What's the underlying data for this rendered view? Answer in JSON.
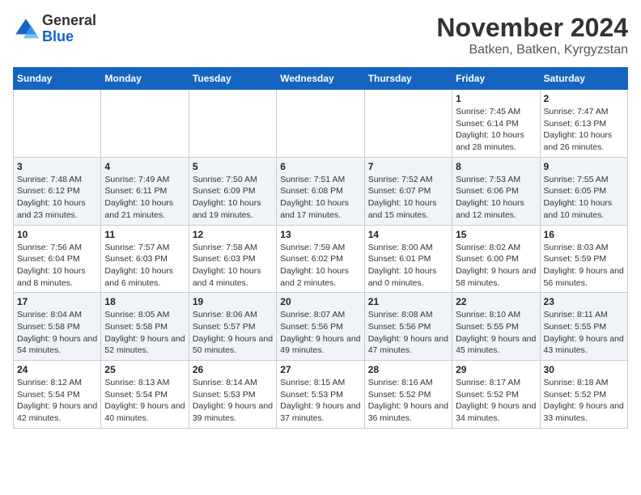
{
  "header": {
    "logo": {
      "general": "General",
      "blue": "Blue"
    },
    "title": "November 2024",
    "location": "Batken, Batken, Kyrgyzstan"
  },
  "weekdays": [
    "Sunday",
    "Monday",
    "Tuesday",
    "Wednesday",
    "Thursday",
    "Friday",
    "Saturday"
  ],
  "weeks": [
    [
      {
        "day": "",
        "info": ""
      },
      {
        "day": "",
        "info": ""
      },
      {
        "day": "",
        "info": ""
      },
      {
        "day": "",
        "info": ""
      },
      {
        "day": "",
        "info": ""
      },
      {
        "day": "1",
        "info": "Sunrise: 7:45 AM\nSunset: 6:14 PM\nDaylight: 10 hours and 28 minutes."
      },
      {
        "day": "2",
        "info": "Sunrise: 7:47 AM\nSunset: 6:13 PM\nDaylight: 10 hours and 26 minutes."
      }
    ],
    [
      {
        "day": "3",
        "info": "Sunrise: 7:48 AM\nSunset: 6:12 PM\nDaylight: 10 hours and 23 minutes."
      },
      {
        "day": "4",
        "info": "Sunrise: 7:49 AM\nSunset: 6:11 PM\nDaylight: 10 hours and 21 minutes."
      },
      {
        "day": "5",
        "info": "Sunrise: 7:50 AM\nSunset: 6:09 PM\nDaylight: 10 hours and 19 minutes."
      },
      {
        "day": "6",
        "info": "Sunrise: 7:51 AM\nSunset: 6:08 PM\nDaylight: 10 hours and 17 minutes."
      },
      {
        "day": "7",
        "info": "Sunrise: 7:52 AM\nSunset: 6:07 PM\nDaylight: 10 hours and 15 minutes."
      },
      {
        "day": "8",
        "info": "Sunrise: 7:53 AM\nSunset: 6:06 PM\nDaylight: 10 hours and 12 minutes."
      },
      {
        "day": "9",
        "info": "Sunrise: 7:55 AM\nSunset: 6:05 PM\nDaylight: 10 hours and 10 minutes."
      }
    ],
    [
      {
        "day": "10",
        "info": "Sunrise: 7:56 AM\nSunset: 6:04 PM\nDaylight: 10 hours and 8 minutes."
      },
      {
        "day": "11",
        "info": "Sunrise: 7:57 AM\nSunset: 6:03 PM\nDaylight: 10 hours and 6 minutes."
      },
      {
        "day": "12",
        "info": "Sunrise: 7:58 AM\nSunset: 6:03 PM\nDaylight: 10 hours and 4 minutes."
      },
      {
        "day": "13",
        "info": "Sunrise: 7:59 AM\nSunset: 6:02 PM\nDaylight: 10 hours and 2 minutes."
      },
      {
        "day": "14",
        "info": "Sunrise: 8:00 AM\nSunset: 6:01 PM\nDaylight: 10 hours and 0 minutes."
      },
      {
        "day": "15",
        "info": "Sunrise: 8:02 AM\nSunset: 6:00 PM\nDaylight: 9 hours and 58 minutes."
      },
      {
        "day": "16",
        "info": "Sunrise: 8:03 AM\nSunset: 5:59 PM\nDaylight: 9 hours and 56 minutes."
      }
    ],
    [
      {
        "day": "17",
        "info": "Sunrise: 8:04 AM\nSunset: 5:58 PM\nDaylight: 9 hours and 54 minutes."
      },
      {
        "day": "18",
        "info": "Sunrise: 8:05 AM\nSunset: 5:58 PM\nDaylight: 9 hours and 52 minutes."
      },
      {
        "day": "19",
        "info": "Sunrise: 8:06 AM\nSunset: 5:57 PM\nDaylight: 9 hours and 50 minutes."
      },
      {
        "day": "20",
        "info": "Sunrise: 8:07 AM\nSunset: 5:56 PM\nDaylight: 9 hours and 49 minutes."
      },
      {
        "day": "21",
        "info": "Sunrise: 8:08 AM\nSunset: 5:56 PM\nDaylight: 9 hours and 47 minutes."
      },
      {
        "day": "22",
        "info": "Sunrise: 8:10 AM\nSunset: 5:55 PM\nDaylight: 9 hours and 45 minutes."
      },
      {
        "day": "23",
        "info": "Sunrise: 8:11 AM\nSunset: 5:55 PM\nDaylight: 9 hours and 43 minutes."
      }
    ],
    [
      {
        "day": "24",
        "info": "Sunrise: 8:12 AM\nSunset: 5:54 PM\nDaylight: 9 hours and 42 minutes."
      },
      {
        "day": "25",
        "info": "Sunrise: 8:13 AM\nSunset: 5:54 PM\nDaylight: 9 hours and 40 minutes."
      },
      {
        "day": "26",
        "info": "Sunrise: 8:14 AM\nSunset: 5:53 PM\nDaylight: 9 hours and 39 minutes."
      },
      {
        "day": "27",
        "info": "Sunrise: 8:15 AM\nSunset: 5:53 PM\nDaylight: 9 hours and 37 minutes."
      },
      {
        "day": "28",
        "info": "Sunrise: 8:16 AM\nSunset: 5:52 PM\nDaylight: 9 hours and 36 minutes."
      },
      {
        "day": "29",
        "info": "Sunrise: 8:17 AM\nSunset: 5:52 PM\nDaylight: 9 hours and 34 minutes."
      },
      {
        "day": "30",
        "info": "Sunrise: 8:18 AM\nSunset: 5:52 PM\nDaylight: 9 hours and 33 minutes."
      }
    ]
  ]
}
